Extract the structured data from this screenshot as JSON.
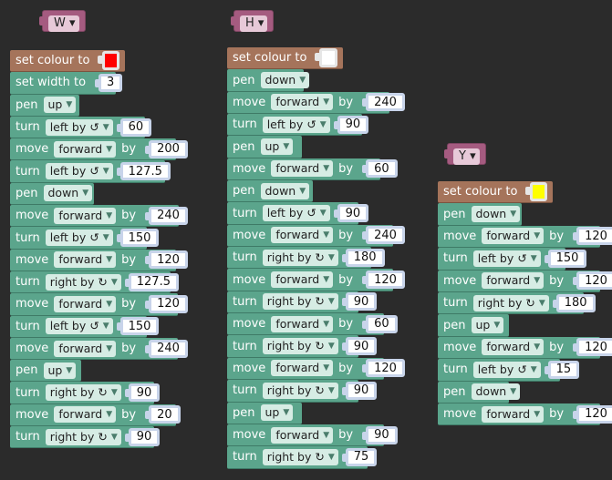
{
  "labels": {
    "set_colour": "set colour to",
    "set_width": "set width to",
    "pen": "pen",
    "move": "move",
    "turn": "turn",
    "by": "by"
  },
  "options": {
    "up": "up",
    "down": "down",
    "forward": "forward",
    "left": "left by ↺",
    "right": "right by ↻"
  },
  "procedures": [
    {
      "name": "W",
      "colour": "#ff0000",
      "blocks": [
        {
          "t": "colour"
        },
        {
          "t": "width",
          "v": "3"
        },
        {
          "t": "pen",
          "o": "up"
        },
        {
          "t": "turn",
          "o": "left",
          "v": "60"
        },
        {
          "t": "move",
          "o": "forward",
          "v": "200"
        },
        {
          "t": "turn",
          "o": "left",
          "v": "127.5"
        },
        {
          "t": "pen",
          "o": "down"
        },
        {
          "t": "move",
          "o": "forward",
          "v": "240"
        },
        {
          "t": "turn",
          "o": "left",
          "v": "150"
        },
        {
          "t": "move",
          "o": "forward",
          "v": "120"
        },
        {
          "t": "turn",
          "o": "right",
          "v": "127.5"
        },
        {
          "t": "move",
          "o": "forward",
          "v": "120"
        },
        {
          "t": "turn",
          "o": "left",
          "v": "150"
        },
        {
          "t": "move",
          "o": "forward",
          "v": "240"
        },
        {
          "t": "pen",
          "o": "up"
        },
        {
          "t": "turn",
          "o": "right",
          "v": "90"
        },
        {
          "t": "move",
          "o": "forward",
          "v": "20"
        },
        {
          "t": "turn",
          "o": "right",
          "v": "90"
        }
      ]
    },
    {
      "name": "H",
      "colour": "#ffffff",
      "blocks": [
        {
          "t": "colour"
        },
        {
          "t": "pen",
          "o": "down"
        },
        {
          "t": "move",
          "o": "forward",
          "v": "240"
        },
        {
          "t": "turn",
          "o": "left",
          "v": "90"
        },
        {
          "t": "pen",
          "o": "up"
        },
        {
          "t": "move",
          "o": "forward",
          "v": "60"
        },
        {
          "t": "pen",
          "o": "down"
        },
        {
          "t": "turn",
          "o": "left",
          "v": "90"
        },
        {
          "t": "move",
          "o": "forward",
          "v": "240"
        },
        {
          "t": "turn",
          "o": "right",
          "v": "180"
        },
        {
          "t": "move",
          "o": "forward",
          "v": "120"
        },
        {
          "t": "turn",
          "o": "right",
          "v": "90"
        },
        {
          "t": "move",
          "o": "forward",
          "v": "60"
        },
        {
          "t": "turn",
          "o": "right",
          "v": "90"
        },
        {
          "t": "move",
          "o": "forward",
          "v": "120"
        },
        {
          "t": "turn",
          "o": "right",
          "v": "90"
        },
        {
          "t": "pen",
          "o": "up"
        },
        {
          "t": "move",
          "o": "forward",
          "v": "90"
        },
        {
          "t": "turn",
          "o": "right",
          "v": "75"
        }
      ]
    },
    {
      "name": "Y",
      "colour": "#ffff00",
      "blocks": [
        {
          "t": "colour"
        },
        {
          "t": "pen",
          "o": "down"
        },
        {
          "t": "move",
          "o": "forward",
          "v": "120"
        },
        {
          "t": "turn",
          "o": "left",
          "v": "150"
        },
        {
          "t": "move",
          "o": "forward",
          "v": "120"
        },
        {
          "t": "turn",
          "o": "right",
          "v": "180"
        },
        {
          "t": "pen",
          "o": "up"
        },
        {
          "t": "move",
          "o": "forward",
          "v": "120"
        },
        {
          "t": "turn",
          "o": "left",
          "v": "15"
        },
        {
          "t": "pen",
          "o": "down"
        },
        {
          "t": "move",
          "o": "forward",
          "v": "120"
        }
      ]
    }
  ]
}
